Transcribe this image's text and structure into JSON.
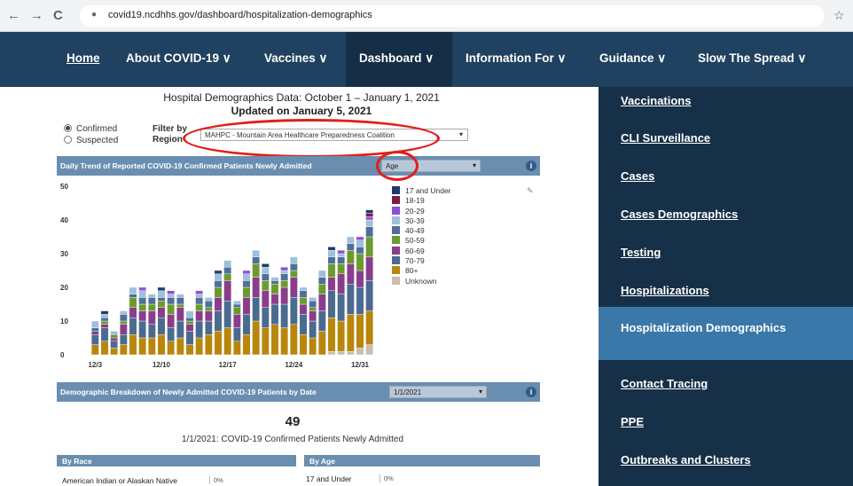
{
  "browser": {
    "url": "covid19.ncdhhs.gov/dashboard/hospitalization-demographics",
    "back": "←",
    "forward": "→",
    "reload": "C",
    "star": "☆"
  },
  "nav": {
    "items": [
      "Home",
      "About COVID-19 ∨",
      "Vaccines ∨",
      "Dashboard ∨",
      "Information For ∨",
      "Guidance ∨",
      "Slow The Spread ∨"
    ],
    "active": "Dashboard ∨"
  },
  "sidebar": {
    "items": [
      "Vaccinations",
      "CLI Surveillance",
      "Cases",
      "Cases Demographics",
      "Testing",
      "Hospitalizations",
      "Hospitalization Demographics",
      "Contact Tracing",
      "PPE",
      "Outbreaks and Clusters"
    ],
    "active": "Hospitalization Demographics"
  },
  "header": {
    "title": "Hospital Demographics Data: October 1 – January 1, 2021",
    "updated": "Updated on January 5, 2021"
  },
  "filters": {
    "confirmed": "Confirmed",
    "suspected": "Suspected",
    "filter_by": "Filter by",
    "region": "Region",
    "region_value": "MAHPC - Mountain Area Healthcare Preparedness Coalition",
    "arrow": "▾"
  },
  "trend": {
    "title": "Daily Trend of Reported COVID-19 Confirmed Patients Newly Admitted",
    "breakdown": "Age",
    "info": "i",
    "pencil": "✎"
  },
  "chart_data": {
    "type": "bar",
    "stacked": true,
    "xlabels": [
      "12/3",
      "12/10",
      "12/17",
      "12/24",
      "12/31"
    ],
    "xlabel_index": [
      0,
      7,
      14,
      21,
      28
    ],
    "yticks": [
      0,
      10,
      20,
      30,
      40,
      50
    ],
    "ylim": [
      0,
      50
    ],
    "categories": [
      "12/3",
      "12/4",
      "12/5",
      "12/6",
      "12/7",
      "12/8",
      "12/9",
      "12/10",
      "12/11",
      "12/12",
      "12/13",
      "12/14",
      "12/15",
      "12/16",
      "12/17",
      "12/18",
      "12/19",
      "12/20",
      "12/21",
      "12/22",
      "12/23",
      "12/24",
      "12/25",
      "12/26",
      "12/27",
      "12/28",
      "12/29",
      "12/30",
      "12/31",
      "1/1"
    ],
    "series": [
      {
        "name": "17 and Under",
        "color": "#1f3a68",
        "values": [
          0,
          1,
          0,
          0,
          0,
          0,
          0,
          1,
          0,
          0,
          0,
          0,
          0,
          1,
          0,
          0,
          0,
          0,
          1,
          0,
          0,
          0,
          0,
          0,
          0,
          1,
          0,
          0,
          0,
          1
        ]
      },
      {
        "name": "18-19",
        "color": "#7b1c46",
        "values": [
          0,
          0,
          0,
          0,
          0,
          0,
          0,
          0,
          0,
          0,
          0,
          0,
          0,
          0,
          0,
          0,
          0,
          0,
          0,
          0,
          0,
          0,
          0,
          0,
          0,
          0,
          0,
          0,
          0,
          1
        ]
      },
      {
        "name": "20-29",
        "color": "#8e4ed8",
        "values": [
          0,
          0,
          0,
          0,
          0,
          1,
          0,
          0,
          1,
          0,
          0,
          1,
          0,
          0,
          0,
          0,
          1,
          0,
          0,
          0,
          1,
          0,
          0,
          0,
          0,
          0,
          1,
          0,
          1,
          1
        ]
      },
      {
        "name": "30-39",
        "color": "#9fc0dc",
        "values": [
          2,
          1,
          1,
          1,
          2,
          2,
          1,
          2,
          1,
          1,
          2,
          1,
          1,
          2,
          2,
          1,
          2,
          2,
          2,
          1,
          1,
          2,
          1,
          1,
          2,
          2,
          1,
          2,
          2,
          2
        ]
      },
      {
        "name": "40-49",
        "color": "#4f6f9a",
        "values": [
          1,
          1,
          0,
          2,
          1,
          2,
          2,
          1,
          2,
          2,
          1,
          2,
          2,
          2,
          2,
          1,
          2,
          2,
          2,
          1,
          2,
          2,
          2,
          2,
          2,
          2,
          2,
          2,
          2,
          3
        ]
      },
      {
        "name": "50-59",
        "color": "#6b9a2e",
        "values": [
          0,
          1,
          1,
          1,
          3,
          2,
          2,
          2,
          3,
          1,
          1,
          2,
          1,
          3,
          2,
          2,
          3,
          4,
          3,
          3,
          2,
          2,
          2,
          1,
          3,
          4,
          3,
          4,
          5,
          6
        ]
      },
      {
        "name": "60-69",
        "color": "#8a3d8c",
        "values": [
          1,
          1,
          1,
          3,
          3,
          3,
          4,
          3,
          4,
          4,
          2,
          3,
          3,
          4,
          6,
          4,
          5,
          6,
          5,
          3,
          5,
          6,
          3,
          3,
          5,
          4,
          6,
          6,
          5,
          7
        ]
      },
      {
        "name": "70-79",
        "color": "#4a6a90",
        "values": [
          3,
          4,
          2,
          3,
          5,
          5,
          4,
          5,
          4,
          5,
          4,
          5,
          4,
          6,
          8,
          4,
          6,
          7,
          6,
          6,
          7,
          8,
          6,
          5,
          6,
          8,
          8,
          9,
          8,
          9
        ]
      },
      {
        "name": "80+",
        "color": "#b8860b",
        "values": [
          3,
          4,
          2,
          3,
          6,
          5,
          5,
          6,
          4,
          5,
          3,
          5,
          6,
          7,
          8,
          4,
          6,
          10,
          8,
          9,
          8,
          9,
          6,
          5,
          7,
          10,
          9,
          11,
          10,
          10
        ]
      },
      {
        "name": "Unknown",
        "color": "#c8bdb0",
        "values": [
          0,
          0,
          0,
          0,
          0,
          0,
          0,
          0,
          0,
          0,
          0,
          0,
          0,
          0,
          0,
          0,
          0,
          0,
          0,
          0,
          0,
          0,
          0,
          0,
          0,
          1,
          1,
          1,
          2,
          3
        ]
      }
    ]
  },
  "demo": {
    "title": "Demographic Breakdown of Newly Admitted COVID-19 Patients by Date",
    "date": "1/1/2021",
    "total": "49",
    "subtitle": "1/1/2021: COVID-19 Confirmed Patients Newly Admitted",
    "by_race": "By Race",
    "by_age": "By Age",
    "race_row": {
      "label": "American Indian or Alaskan Native",
      "value": "0%"
    },
    "age_row": {
      "label": "17 and Under",
      "value": "0%"
    }
  },
  "colors": {
    "nav": "#20415f",
    "sidebar": "#163047",
    "active": "#3a78a9",
    "band": "#6a8eb0",
    "annotation": "#e0201b"
  }
}
